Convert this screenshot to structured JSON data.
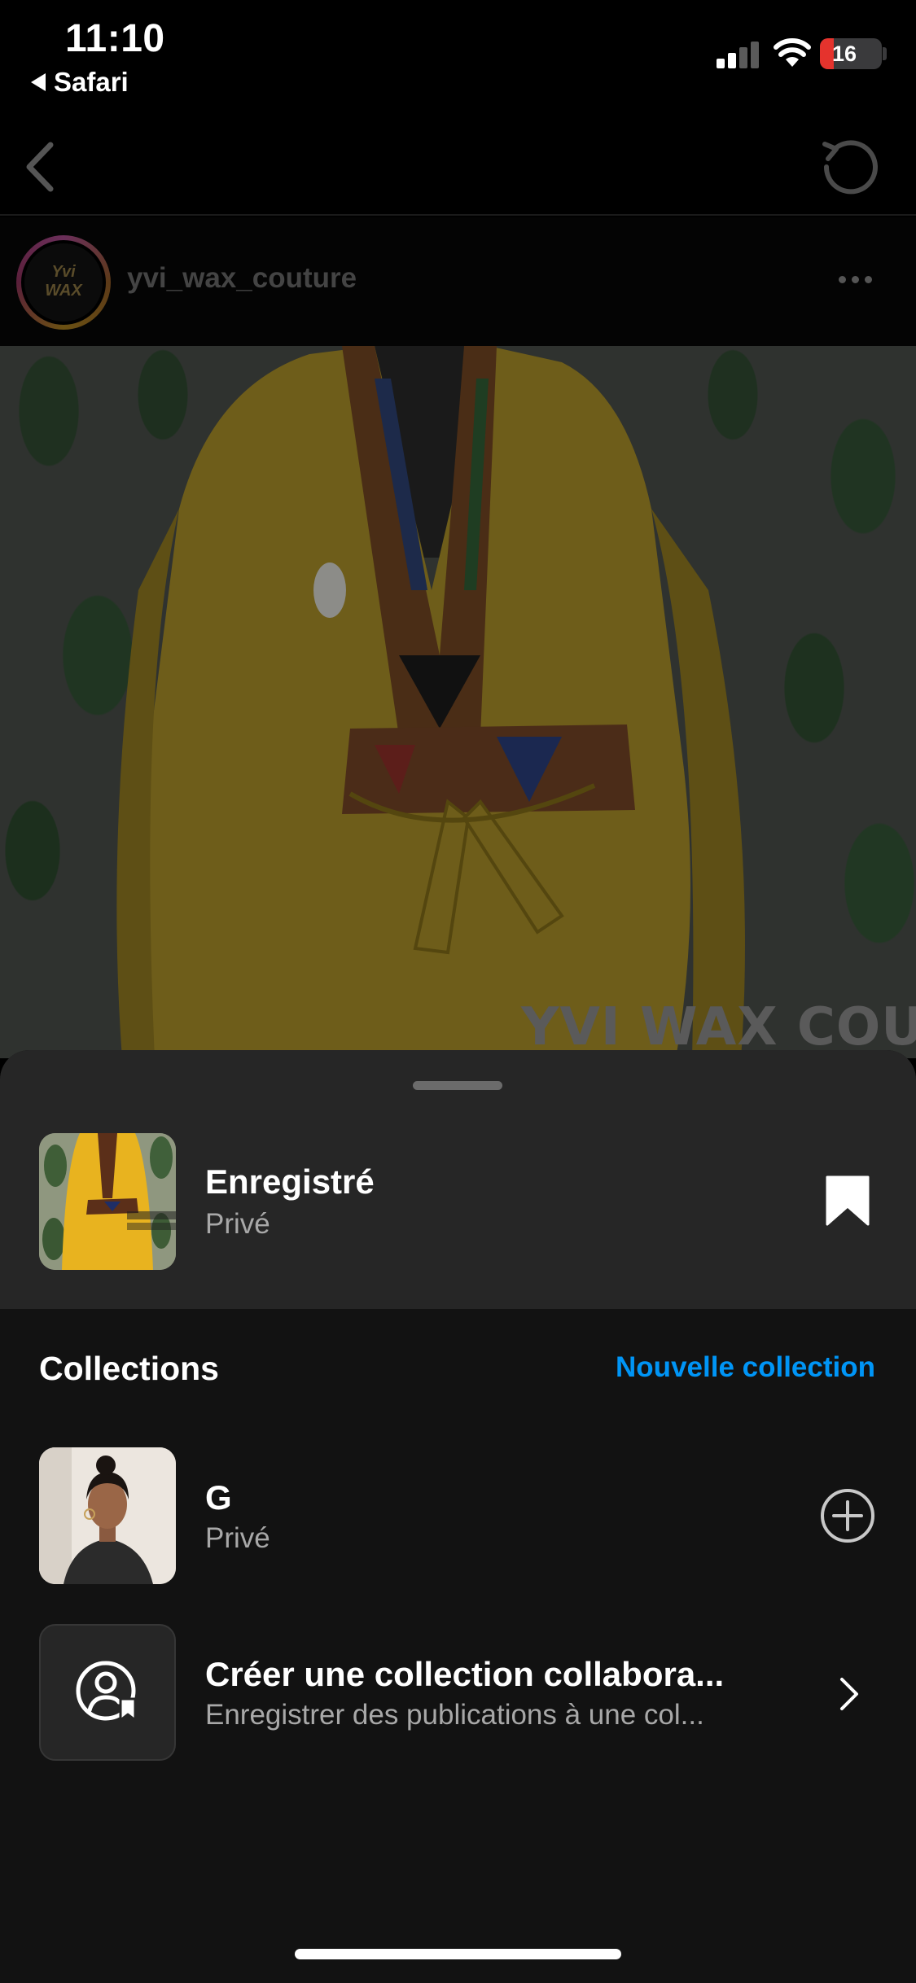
{
  "status_bar": {
    "time": "11:10",
    "back_app": "Safari",
    "battery_level": "16",
    "battery_color": "#e5332d"
  },
  "post": {
    "username": "yvi_wax_couture",
    "avatar_text": "Yvi WAX",
    "watermark": "YVI WAX COUTUR",
    "icons": {
      "back": "chevron-left-icon",
      "refresh": "refresh-icon",
      "more": "more-dots-icon"
    }
  },
  "sheet": {
    "saved": {
      "title": "Enregistré",
      "subtitle": "Privé",
      "icon": "bookmark-filled-icon"
    },
    "collections_heading": "Collections",
    "new_collection_label": "Nouvelle collection",
    "items": [
      {
        "name": "G",
        "subtitle": "Privé",
        "action_icon": "plus-circle-icon"
      },
      {
        "name": "Créer une collection collabora...",
        "subtitle": "Enregistrer des publications à une col...",
        "action_icon": "chevron-right-icon"
      }
    ]
  },
  "colors": {
    "accent": "#0095f6",
    "sheet_background": "#121212",
    "sheet_header_background": "#262626",
    "secondary_text": "#a8a8a8"
  }
}
